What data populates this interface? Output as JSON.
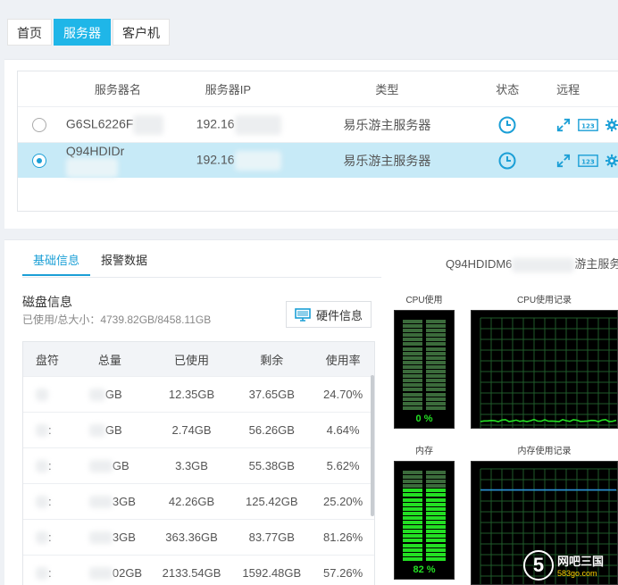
{
  "nav": {
    "tabs": [
      {
        "label": "首页"
      },
      {
        "label": "服务器"
      },
      {
        "label": "客户机"
      }
    ],
    "active": 1
  },
  "server_table": {
    "headers": {
      "name": "服务器名",
      "ip": "服务器IP",
      "type": "类型",
      "status": "状态",
      "remote": "远程"
    },
    "rows": [
      {
        "name": "G6SL6226F",
        "ip": "192.16",
        "type": "易乐游主服务器",
        "selected": false
      },
      {
        "name": "Q94HDIDr",
        "ip": "192.16",
        "type": "易乐游主服务器",
        "selected": true
      }
    ]
  },
  "info": {
    "tabs": [
      {
        "label": "基础信息"
      },
      {
        "label": "报警数据"
      }
    ],
    "server_title": "Q94HDIDM6",
    "server_title_suffix": "游主服务器",
    "disk": {
      "title": "磁盘信息",
      "usage": "已使用/总大小：4739.82GB/8458.11GB",
      "hw_button": "硬件信息",
      "headers": {
        "drive": "盘符",
        "total": "总量",
        "used": "已使用",
        "free": "剩余",
        "rate": "使用率"
      },
      "rows": [
        {
          "drive": "",
          "total": "GB",
          "used": "12.35GB",
          "free": "37.65GB",
          "rate": "24.70%"
        },
        {
          "drive": ":",
          "total": "GB",
          "used": "2.74GB",
          "free": "56.26GB",
          "rate": "4.64%"
        },
        {
          "drive": ":",
          "total": "GB",
          "used": "3.3GB",
          "free": "55.38GB",
          "rate": "5.62%"
        },
        {
          "drive": ":",
          "total": "3GB",
          "used": "42.26GB",
          "free": "125.42GB",
          "rate": "25.20%"
        },
        {
          "drive": ":",
          "total": "3GB",
          "used": "363.36GB",
          "free": "83.77GB",
          "rate": "81.26%"
        },
        {
          "drive": ":",
          "total": "02GB",
          "used": "2133.54GB",
          "free": "1592.48GB",
          "rate": "57.26%"
        }
      ]
    }
  },
  "monitor": {
    "cpu_label": "CPU使用",
    "cpu_history_label": "CPU使用记录",
    "cpu_value": "0 %",
    "cpu_fraction": 0.0,
    "mem_label": "内存",
    "mem_history_label": "内存使用记录",
    "mem_value": "82 %",
    "mem_fraction": 0.82,
    "line_color": "#23e023",
    "mem_line_color": "#2a8fd8"
  },
  "watermark": {
    "digit": "5",
    "main": "网吧三国",
    "sub": "583go.com"
  },
  "icons": {
    "status": "clock-icon",
    "remote": [
      "expand-icon",
      "numpad-icon",
      "gear-icon"
    ],
    "hw": "monitor-icon"
  },
  "colors": {
    "accent": "#1fb6e8",
    "selected_row": "#c7eaf7"
  }
}
